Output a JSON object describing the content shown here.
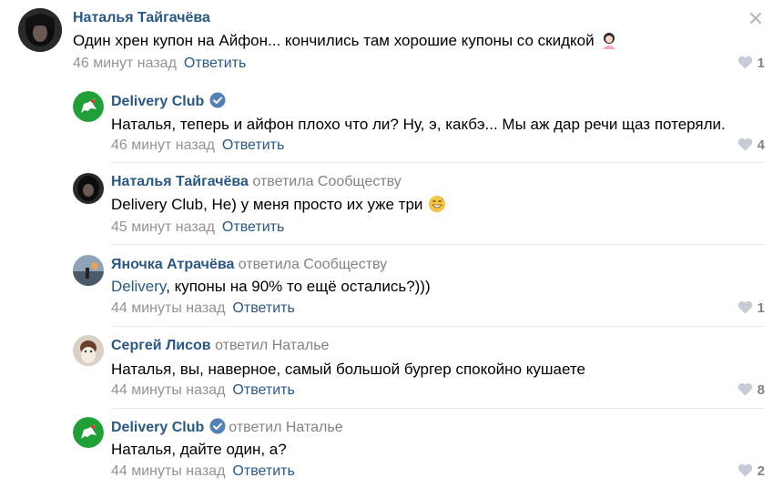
{
  "comments": [
    {
      "author": "Наталья Тайгачёва",
      "replied_to": "",
      "verified": false,
      "text": "Один хрен купон на Айфон... кончились там хорошие купоны со скидкой",
      "time": "46 минут назад",
      "reply_label": "Ответить",
      "likes": "1",
      "emoji": "woman-emoji"
    },
    {
      "author": "Delivery Club",
      "replied_to": "",
      "verified": true,
      "text": "Наталья, теперь и айфон плохо что ли? Ну, э, какбэ... Мы аж дар речи щаз потеряли.",
      "time": "46 минут назад",
      "reply_label": "Ответить",
      "likes": "4"
    },
    {
      "author": "Наталья Тайгачёва",
      "replied_to": "ответила Сообществу",
      "verified": false,
      "text": "Delivery Club, Не) у меня просто их уже три",
      "time": "45 минут назад",
      "reply_label": "Ответить",
      "likes": "",
      "emoji": "grin-sweat-emoji"
    },
    {
      "author": "Яночка Атрачёва",
      "replied_to": "ответила Сообществу",
      "verified": false,
      "mention": "Delivery",
      "text": ", купоны на 90% то ещё остались?)))",
      "time": "44 минуты назад",
      "reply_label": "Ответить",
      "likes": "1"
    },
    {
      "author": "Сергей Лисов",
      "replied_to": "ответил Наталье",
      "verified": false,
      "text": "Наталья, вы, наверное, самый большой бургер спокойно кушаете",
      "time": "44 минуты назад",
      "reply_label": "Ответить",
      "likes": "8"
    },
    {
      "author": "Delivery Club",
      "replied_to": "ответил Наталье",
      "verified": true,
      "text": "Наталья, дайте один, а?",
      "time": "44 минуты назад",
      "reply_label": "Ответить",
      "likes": "2"
    }
  ],
  "colors": {
    "link": "#2a5885",
    "muted": "#939393",
    "divider": "#e7e8ec",
    "brand_green": "#21a038",
    "verified_blue": "#5181b8"
  }
}
